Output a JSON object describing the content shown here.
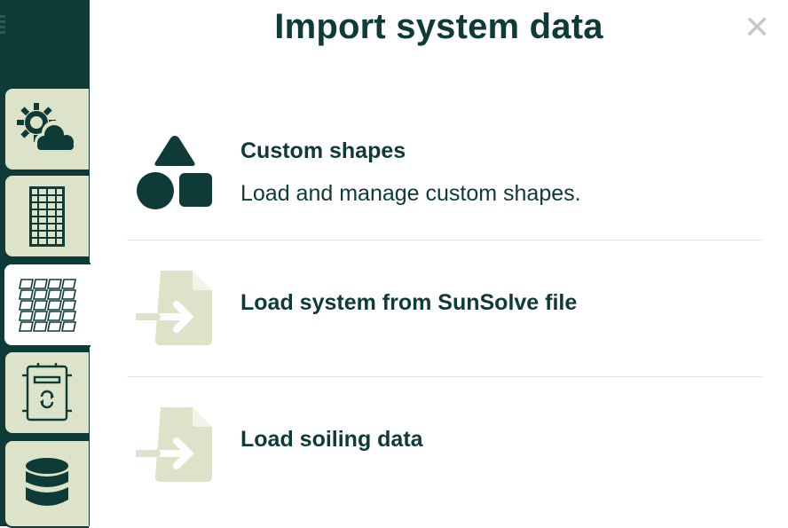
{
  "dialog": {
    "title": "Import system data",
    "close_icon": "close-icon"
  },
  "sidebar": {
    "tabs": [
      {
        "icon": "sun-cloud-icon",
        "active": false
      },
      {
        "icon": "solar-panel-icon",
        "active": false
      },
      {
        "icon": "panel-array-icon",
        "active": true
      },
      {
        "icon": "inverter-icon",
        "active": false
      },
      {
        "icon": "database-icon",
        "active": false
      }
    ]
  },
  "options": [
    {
      "title": "Custom shapes",
      "description": "Load and manage custom shapes.",
      "icon": "shapes-icon"
    },
    {
      "title": "Load system from SunSolve file",
      "icon": "file-import-icon"
    },
    {
      "title": "Load soiling data",
      "icon": "file-import-icon"
    }
  ],
  "colors": {
    "primary": "#0e3b37",
    "tab_background": "#dde3c8",
    "muted_icon": "#dde3c8",
    "divider": "#e3e3e3",
    "close": "#c8c8c8"
  }
}
